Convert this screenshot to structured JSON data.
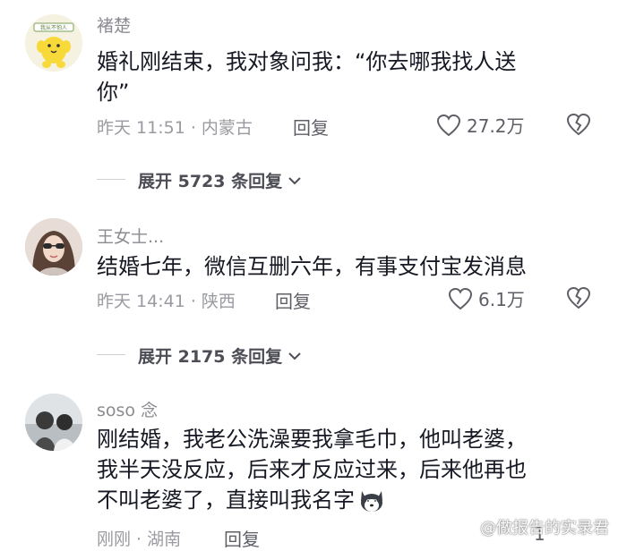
{
  "comments": [
    {
      "username": "褚楚",
      "body_lines": [
        "婚礼刚结束，我对象问我：“你去哪我找人送",
        "你”"
      ],
      "time_location": "昨天 11:51 · 内蒙古",
      "reply_label": "回复",
      "likes": "27.2万",
      "avatar_badge_text": "我从不怕人",
      "expand_label": "展开 5723 条回复"
    },
    {
      "username": "王女士...",
      "body_lines": [
        "结婚七年，微信互删六年，有事支付宝发消息"
      ],
      "time_location": "昨天 14:41 · 陕西",
      "reply_label": "回复",
      "likes": "6.1万",
      "expand_label": "展开 2175 条回复"
    },
    {
      "username": "soso 念",
      "body_lines": [
        "刚结婚，我老公洗澡要我拿毛巾，他叫老婆，",
        "我半天没反应，后来才反应过来，后来他再也",
        "不叫老婆了，直接叫我名字"
      ],
      "time_location": "刚刚 · 湖南",
      "reply_label": "回复",
      "likes": "1"
    }
  ],
  "watermark": "@做报告的实录君",
  "colors": {
    "text_primary": "#161823",
    "text_secondary": "#8a8b91",
    "accent_yellow": "#f7d93a"
  }
}
